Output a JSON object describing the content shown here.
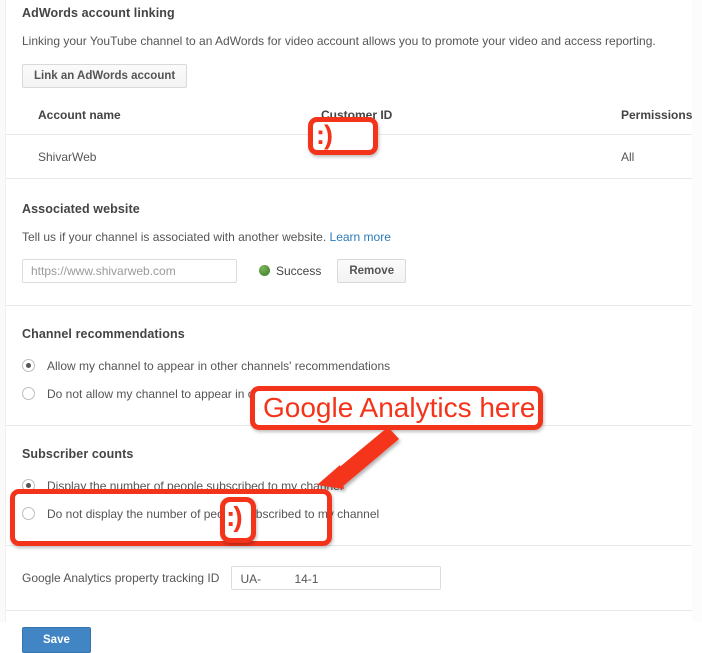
{
  "adwords": {
    "title": "AdWords account linking",
    "description": "Linking your YouTube channel to an AdWords for video account allows you to promote your video and access reporting.",
    "link_button": "Link an AdWords account",
    "table": {
      "headers": [
        "Account name",
        "Customer ID",
        "Permissions"
      ],
      "rows": [
        {
          "account_name": "ShivarWeb",
          "customer_id": "",
          "permissions": "All"
        }
      ]
    }
  },
  "associated_website": {
    "title": "Associated website",
    "description": "Tell us if your channel is associated with another website.",
    "learn_more": "Learn more",
    "input_value": "https://www.shivarweb.com",
    "status_label": "Success",
    "status_color": "#4f8a36",
    "remove_button": "Remove"
  },
  "channel_recommendations": {
    "title": "Channel recommendations",
    "options": [
      {
        "label": "Allow my channel to appear in other channels' recommendations",
        "selected": true
      },
      {
        "label": "Do not allow my channel to appear in other channels' recommendations",
        "selected": false
      }
    ]
  },
  "subscriber_counts": {
    "title": "Subscriber counts",
    "options": [
      {
        "label": "Display the number of people subscribed to my channel",
        "selected": true
      },
      {
        "label": "Do not display the number of people subscribed to my channel",
        "selected": false
      }
    ]
  },
  "google_analytics": {
    "label": "Google Analytics property tracking ID",
    "value_prefix": "UA-",
    "value_suffix": "14-1"
  },
  "footer": {
    "save_button": "Save"
  },
  "annotations": {
    "color": "#f4341a",
    "callout_text": "Google Analytics here",
    "redaction_glyph": ":)"
  }
}
